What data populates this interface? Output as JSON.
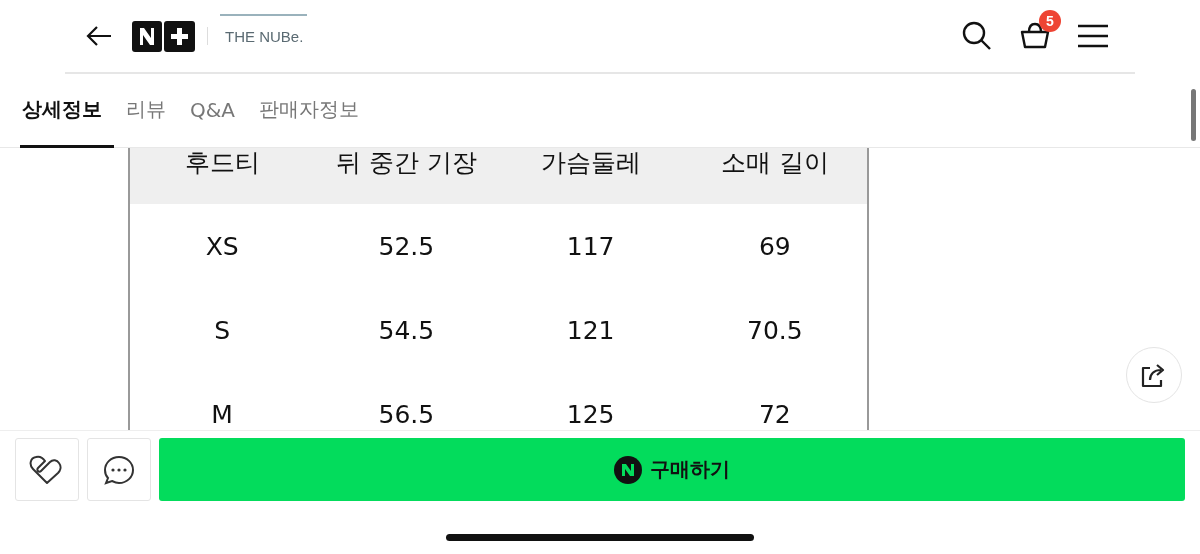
{
  "header": {
    "brand_tagline": "THE NUBe.",
    "cart_count": "5"
  },
  "tabs": [
    {
      "label": "상세정보",
      "selected": true
    },
    {
      "label": "리뷰",
      "selected": false
    },
    {
      "label": "Q&A",
      "selected": false
    },
    {
      "label": "판매자정보",
      "selected": false
    }
  ],
  "size_table": {
    "columns": [
      "후드티",
      "뒤 중간 기장",
      "가슴둘레",
      "소매 길이"
    ],
    "rows": [
      [
        "XS",
        "52.5",
        "117",
        "69"
      ],
      [
        "S",
        "54.5",
        "121",
        "70.5"
      ],
      [
        "M",
        "56.5",
        "125",
        "72"
      ]
    ]
  },
  "bottom_bar": {
    "buy_label": "구매하기"
  }
}
